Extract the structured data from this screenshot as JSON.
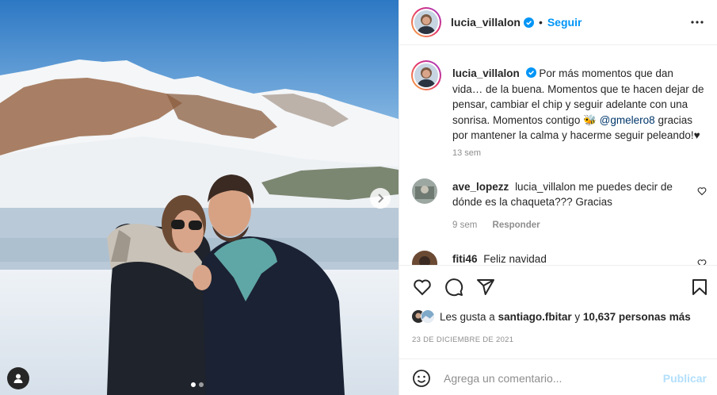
{
  "post": {
    "author": "lucia_villalon",
    "follow_label": "Seguir",
    "separator": "•"
  },
  "caption": {
    "username": "lucia_villalon",
    "text_1": "Por más momentos que dan vida… de la buena. Momentos que te hacen dejar de pensar, cambiar el chip y seguir adelante con una sonrisa. Momentos contigo",
    "emoji": "🐝",
    "mention": "@gmelero8",
    "text_2": "gracias por mantener la calma y hacerme seguir peleando!♥",
    "time": "13 sem"
  },
  "comments": [
    {
      "username": "ave_lopezz",
      "text": "lucia_villalon me puedes decir de dónde es la chaqueta??? Gracias",
      "time": "9 sem",
      "reply_label": "Responder"
    },
    {
      "username": "fiti46",
      "text": "Feliz navidad"
    }
  ],
  "likes": {
    "prefix": "Les gusta a",
    "user": "santiago.fbitar",
    "connector": "y",
    "others": "10,637 personas más"
  },
  "date": "23 DE DICIEMBRE DE 2021",
  "composer": {
    "placeholder": "Agrega un comentario...",
    "publish_label": "Publicar"
  },
  "colors": {
    "accent": "#0095f6",
    "publish_disabled": "#b2dffc",
    "mention": "#00376b"
  },
  "carousel": {
    "current": 1,
    "total": 2
  },
  "icons": [
    "verified-icon",
    "more-icon",
    "chevron-right-icon",
    "user-tag-icon",
    "heart-icon",
    "comment-icon",
    "share-icon",
    "bookmark-icon",
    "emoji-icon"
  ]
}
